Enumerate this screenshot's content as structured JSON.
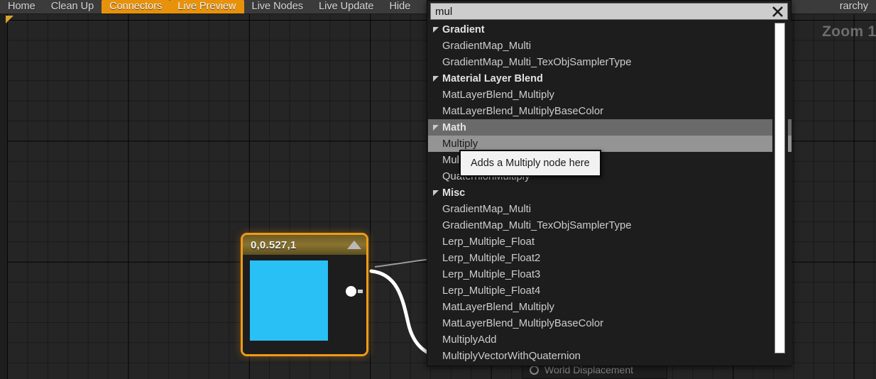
{
  "toolbar": {
    "items": [
      {
        "label": "Home",
        "active": false
      },
      {
        "label": "Clean Up",
        "active": false
      },
      {
        "label": "Connectors",
        "active": true
      },
      {
        "label": "Live Preview",
        "active": true
      },
      {
        "label": "Live Nodes",
        "active": false
      },
      {
        "label": "Live Update",
        "active": false
      },
      {
        "label": "Hide",
        "active": false
      },
      {
        "label": "rarchy",
        "active": false
      }
    ]
  },
  "canvas": {
    "zoom_label": "Zoom 1"
  },
  "search": {
    "value": "mul",
    "placeholder": "",
    "clear_icon": "close-icon"
  },
  "results": [
    {
      "type": "category",
      "label": "Gradient",
      "highlighted": false
    },
    {
      "type": "item",
      "label": "GradientMap_Multi",
      "selected": false
    },
    {
      "type": "item",
      "label": "GradientMap_Multi_TexObjSamplerType",
      "selected": false
    },
    {
      "type": "category",
      "label": "Material Layer Blend",
      "highlighted": false
    },
    {
      "type": "item",
      "label": "MatLayerBlend_Multiply",
      "selected": false
    },
    {
      "type": "item",
      "label": "MatLayerBlend_MultiplyBaseColor",
      "selected": false
    },
    {
      "type": "category",
      "label": "Math",
      "highlighted": true
    },
    {
      "type": "item",
      "label": "Multiply",
      "selected": true
    },
    {
      "type": "item",
      "label": "MultiplyAdd",
      "selected": false
    },
    {
      "type": "item",
      "label": "QuaternionMultiply",
      "selected": false
    },
    {
      "type": "category",
      "label": "Misc",
      "highlighted": false
    },
    {
      "type": "item",
      "label": "GradientMap_Multi",
      "selected": false
    },
    {
      "type": "item",
      "label": "GradientMap_Multi_TexObjSamplerType",
      "selected": false
    },
    {
      "type": "item",
      "label": "Lerp_Multiple_Float",
      "selected": false
    },
    {
      "type": "item",
      "label": "Lerp_Multiple_Float2",
      "selected": false
    },
    {
      "type": "item",
      "label": "Lerp_Multiple_Float3",
      "selected": false
    },
    {
      "type": "item",
      "label": "Lerp_Multiple_Float4",
      "selected": false
    },
    {
      "type": "item",
      "label": "MatLayerBlend_Multiply",
      "selected": false
    },
    {
      "type": "item",
      "label": "MatLayerBlend_MultiplyBaseColor",
      "selected": false
    },
    {
      "type": "item",
      "label": "MultiplyAdd",
      "selected": false
    },
    {
      "type": "item",
      "label": "MultiplyVectorWithQuaternion",
      "selected": false
    }
  ],
  "tooltip": {
    "text": "Adds a Multiply node here"
  },
  "node": {
    "title": "0,0.527,1",
    "swatch_color": "#29c0f5",
    "collapse_icon": "triangle-up-icon",
    "output_pin": "output-pin"
  },
  "bottom_panel": {
    "label": "World Displacement",
    "pin_icon": "circle-pin-icon"
  },
  "colors": {
    "accent_orange": "#e8920c",
    "node_border": "#f09b17",
    "selection_gray": "#949494",
    "category_highlight": "#6a6a6a"
  }
}
